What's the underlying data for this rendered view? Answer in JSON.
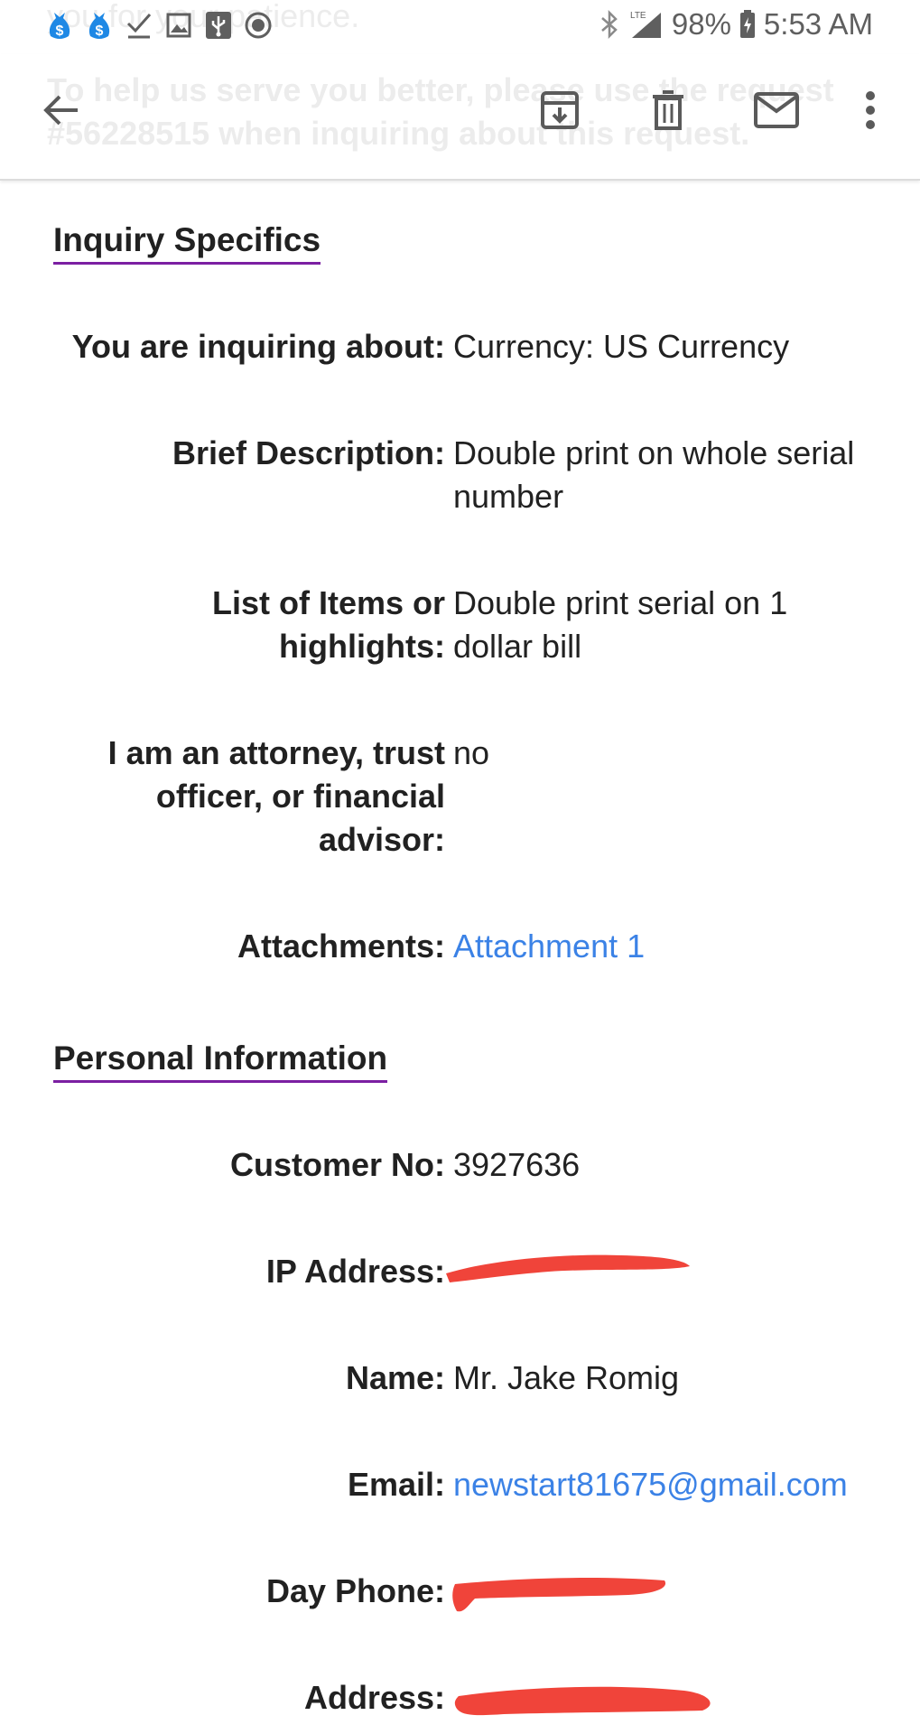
{
  "ghost_text": {
    "line0": "you for your patience.",
    "line1": "To help us serve you better, please use the request",
    "line2": "#56228515 when inquiring about this request."
  },
  "status_bar": {
    "left_icons": [
      "money-bag-icon",
      "money-bag-icon",
      "check-icon",
      "image-icon",
      "usb-icon",
      "sync-icon"
    ],
    "battery": "98%",
    "time": "5:53 AM",
    "network": "LTE"
  },
  "app_bar": {
    "icons": [
      "back-arrow-icon",
      "archive-icon",
      "delete-icon",
      "mail-icon",
      "more-vert-icon"
    ]
  },
  "sections": {
    "inquiry": {
      "title": "Inquiry Specifics",
      "rows": [
        {
          "label": "You are inquiring about:",
          "value": "Currency: US Currency"
        },
        {
          "label": "Brief Description:",
          "value": "Double print on whole serial number"
        },
        {
          "label": "List of Items or highlights:",
          "value": "Double print serial on 1 dollar bill"
        },
        {
          "label": "I am an attorney, trust officer, or financial advisor:",
          "value": "no"
        },
        {
          "label": "Attachments:",
          "value": "Attachment 1"
        }
      ]
    },
    "personal": {
      "title": "Personal Information",
      "rows": [
        {
          "label": "Customer No:",
          "value": "3927636"
        },
        {
          "label": "IP Address:",
          "value": ""
        },
        {
          "label": "Name:",
          "value": "Mr. Jake Romig"
        },
        {
          "label": "Email:",
          "value": "newstart81675@gmail.com"
        },
        {
          "label": "Day Phone:",
          "value": ""
        },
        {
          "label": "Address:",
          "value": ""
        }
      ]
    }
  },
  "colors": {
    "link": "#3b82e6",
    "heading_underline": "#7b1fa2",
    "redaction": "#f0443a",
    "status_icon_blue": "#1e88e5"
  }
}
